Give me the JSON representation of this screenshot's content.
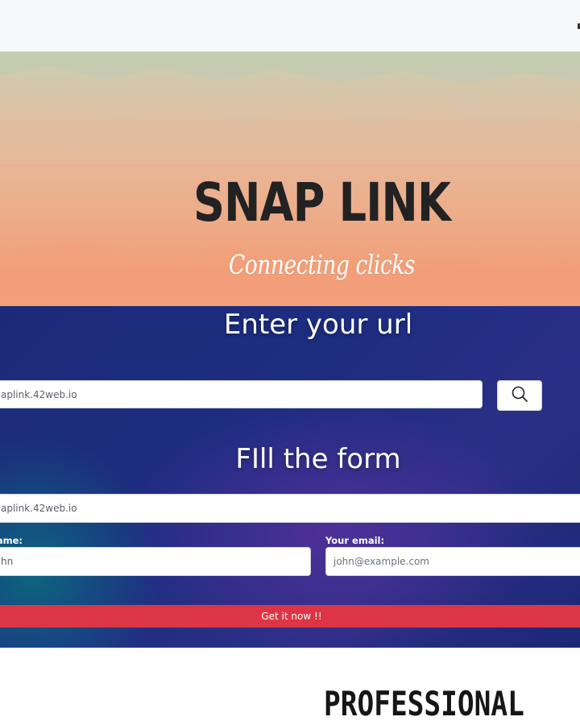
{
  "header": {
    "title": "SNAP LINK",
    "tagline": "Connecting clicks"
  },
  "url_section": {
    "heading": "Enter your url",
    "url_value": "aplink.42web.io",
    "search_icon": "search-icon"
  },
  "form_section": {
    "heading": "FIll the form",
    "url_label": ":",
    "url_value": "aplink.42web.io",
    "name_label": "r name:",
    "name_value": "hn",
    "email_label": "Your email:",
    "email_placeholder": "john@example.com",
    "submit_label": "Get it now !!"
  },
  "footer": {
    "banner_text": "PROFESSIONAL U"
  },
  "colors": {
    "hero_top": "#c8cfb4",
    "hero_bottom": "#f29e78",
    "main_bg": "#1d2d80",
    "submit_bg": "#dc3545",
    "title_text": "#222222"
  }
}
